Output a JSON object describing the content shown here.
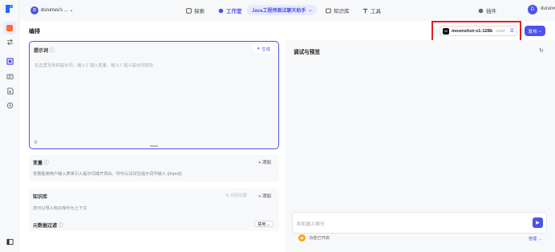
{
  "header": {
    "workspace_initial": "D",
    "workspace_name": "durunwu's ... ⌄",
    "nav": [
      {
        "label": "探索",
        "icon": "explore-icon"
      },
      {
        "label": "工作室",
        "icon": "studio-icon"
      },
      {
        "label": "知识库",
        "icon": "knowledge-icon"
      },
      {
        "label": "工具",
        "icon": "tools-icon"
      }
    ],
    "project_name": "Java工程师面试聊天助手",
    "plugin_label": "插件",
    "user_initial": "D",
    "username": "durunwu"
  },
  "edit": {
    "title": "编排",
    "model": {
      "logo": "M",
      "name": "moonshot-v1-128k",
      "tag": "CHAT"
    },
    "publish_label": "发布"
  },
  "prompt": {
    "label": "提示词",
    "generate_label": "生成",
    "placeholder": "在这里写你的提示词，输入'{' 插入变量、输入'/' 插入提示内容块",
    "count": "0"
  },
  "variables": {
    "title": "变量",
    "add_label": "添加",
    "desc": "变量能使用户输入表单引入提示词或开场白，你可以试试在提示词中输入 {{input}}"
  },
  "knowledge": {
    "title": "知识库",
    "smart_label": "召回设置",
    "add_label": "添加",
    "desc": "您可以导入知识库作为上下文"
  },
  "metadata_filter": {
    "title": "元数据过滤",
    "select_value": "禁用 ⌄"
  },
  "debug": {
    "title": "调试与预览",
    "chat_placeholder": "和机器人聊天",
    "feature_label": "功能已开启",
    "manage_label": "管理 →"
  },
  "colors": {
    "accent": "#4d53e8",
    "highlight_box": "#e02020"
  }
}
